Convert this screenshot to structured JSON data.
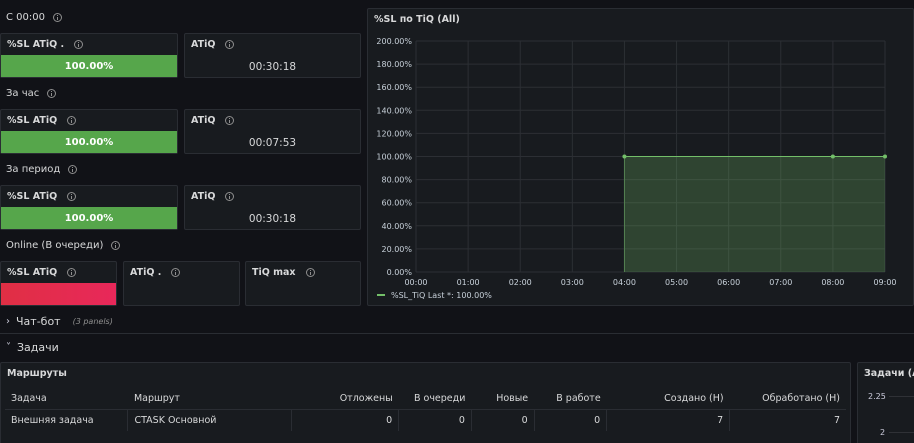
{
  "sections": {
    "since_midnight": "С 00:00",
    "last_hour": "За час",
    "period": "За период",
    "online": "Online (В очереди)",
    "chatbot": "Чат-бот",
    "chatbot_panels": "(3 panels)",
    "tasks": "Задачи"
  },
  "stats": {
    "row1": {
      "sl_title": "%SL ATiQ .",
      "sl_value": "100.00%",
      "atiq_title": "ATiQ",
      "atiq_value": "00:30:18"
    },
    "row2": {
      "sl_title": "%SL ATiQ",
      "sl_value": "100.00%",
      "atiq_title": "ATiQ",
      "atiq_value": "00:07:53"
    },
    "row3": {
      "sl_title": "%SL ATiQ",
      "sl_value": "100.00%",
      "atiq_title": "ATiQ",
      "atiq_value": "00:30:18"
    },
    "row4": {
      "sl_title": "%SL ATiQ",
      "atiq_title": "ATiQ .",
      "tiq_max_title": "TiQ max"
    }
  },
  "colors": {
    "green": "#56a64b",
    "red": "#e02f44",
    "series": "#73bf69"
  },
  "chart_data": {
    "type": "area",
    "title": "%SL по TiQ (All)",
    "x": [
      "00:00",
      "01:00",
      "02:00",
      "03:00",
      "04:00",
      "05:00",
      "06:00",
      "07:00",
      "08:00",
      "09:00"
    ],
    "y_ticks": [
      "0.00%",
      "20.00%",
      "40.00%",
      "60.00%",
      "80.00%",
      "100.00%",
      "120.00%",
      "140.00%",
      "160.00%",
      "180.00%",
      "200.00%"
    ],
    "ylim": [
      0,
      200
    ],
    "series": [
      {
        "name": "%SL_TiQ",
        "points": [
          [
            "04:00",
            100
          ],
          [
            "08:00",
            100
          ],
          [
            "09:00",
            100
          ]
        ]
      }
    ],
    "legend_text": "%SL_TiQ  Last *: 100.00%",
    "grid": true,
    "legend": "bottom-left"
  },
  "routes": {
    "title": "Маршруты",
    "columns": [
      "Задача",
      "Маршрут",
      "Отложены",
      "В очереди",
      "Новые",
      "В работе",
      "Создано (Н)",
      "Обработано (Н)"
    ],
    "rows": [
      [
        "Внешняя задача",
        "CTASK Основной",
        "0",
        "0",
        "0",
        "0",
        "7",
        "7"
      ]
    ]
  },
  "tasks_all": {
    "title": "Задачи (All",
    "ticks": [
      "2.25",
      "2"
    ]
  }
}
